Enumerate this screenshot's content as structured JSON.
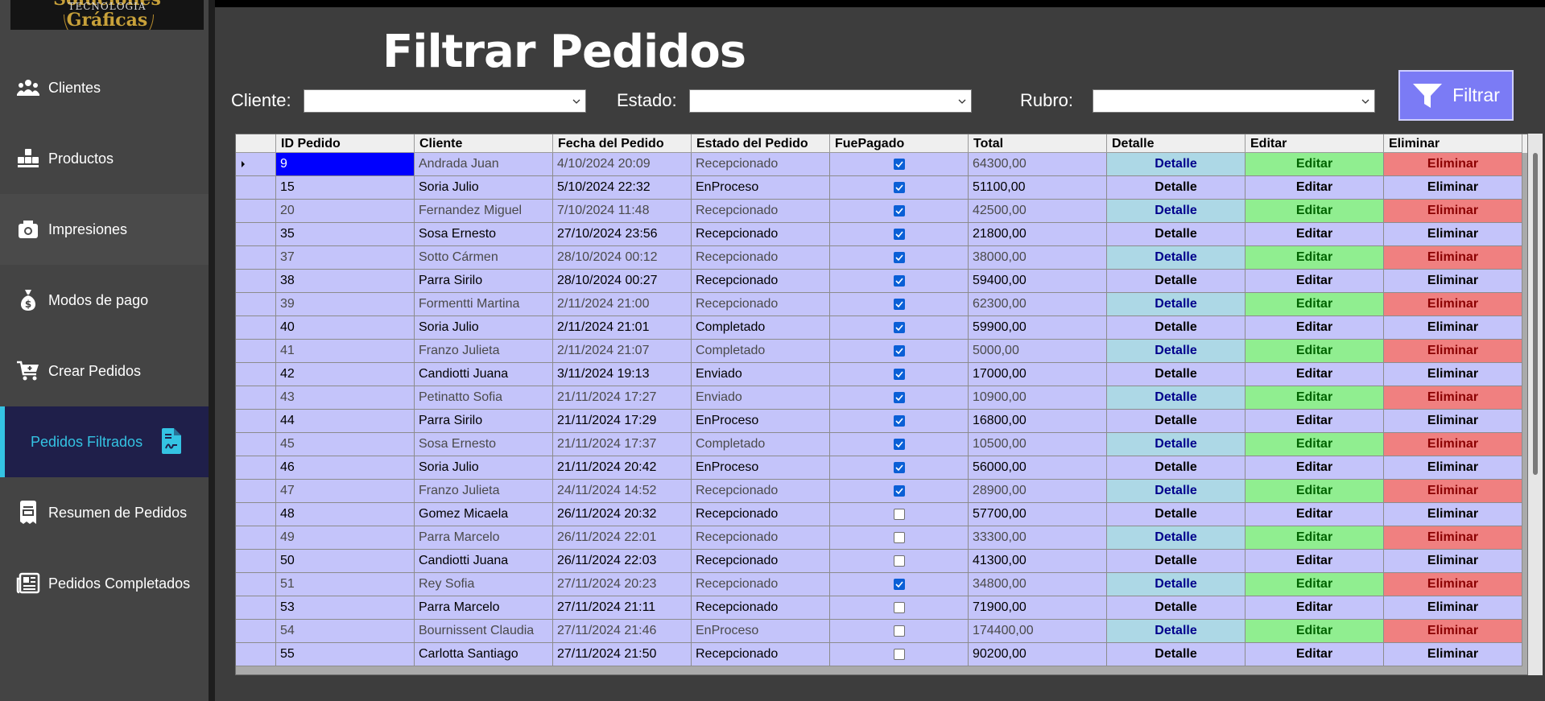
{
  "logo": {
    "brand": "Soluciones Gráficas",
    "sub": "TECNOLOGIA"
  },
  "sidebar": {
    "items": [
      {
        "label": "Clientes",
        "icon": "clients-icon"
      },
      {
        "label": "Productos",
        "icon": "products-icon"
      },
      {
        "label": "Impresiones",
        "icon": "print-icon"
      },
      {
        "label": "Modos de pago",
        "icon": "money-bag-icon"
      },
      {
        "label": "Crear Pedidos",
        "icon": "cart-icon"
      },
      {
        "label": "Pedidos Filtrados",
        "icon": "document-signature-icon"
      },
      {
        "label": "Resumen de Pedidos",
        "icon": "receipt-icon"
      },
      {
        "label": "Pedidos Completados",
        "icon": "newspaper-icon"
      }
    ],
    "active": "Pedidos Filtrados",
    "accent": "#34c3e3"
  },
  "page": {
    "title": "Filtrar Pedidos"
  },
  "filters": {
    "cliente_label": "Cliente:",
    "estado_label": "Estado:",
    "rubro_label": "Rubro:",
    "cliente_value": "",
    "estado_value": "",
    "rubro_value": "",
    "button_label": "Filtrar"
  },
  "table": {
    "columns": [
      "ID Pedido",
      "Cliente",
      "Fecha del Pedido",
      "Estado del Pedido",
      "FuePagado",
      "Total",
      "Detalle",
      "Editar",
      "Eliminar"
    ],
    "button_labels": {
      "detalle": "Detalle",
      "editar": "Editar",
      "eliminar": "Eliminar"
    },
    "rows": [
      {
        "id": "9",
        "cliente": "Andrada Juan",
        "fecha": "4/10/2024 20:09",
        "estado": "Recepcionado",
        "pagado": true,
        "total": "64300,00"
      },
      {
        "id": "15",
        "cliente": "Soria Julio",
        "fecha": "5/10/2024 22:32",
        "estado": "EnProceso",
        "pagado": true,
        "total": "51100,00"
      },
      {
        "id": "20",
        "cliente": "Fernandez Miguel",
        "fecha": "7/10/2024 11:48",
        "estado": "Recepcionado",
        "pagado": true,
        "total": "42500,00"
      },
      {
        "id": "35",
        "cliente": "Sosa Ernesto",
        "fecha": "27/10/2024 23:56",
        "estado": "Recepcionado",
        "pagado": true,
        "total": "21800,00"
      },
      {
        "id": "37",
        "cliente": "Sotto Cármen",
        "fecha": "28/10/2024 00:12",
        "estado": "Recepcionado",
        "pagado": true,
        "total": "38000,00"
      },
      {
        "id": "38",
        "cliente": "Parra Sirilo",
        "fecha": "28/10/2024 00:27",
        "estado": "Recepcionado",
        "pagado": true,
        "total": "59400,00"
      },
      {
        "id": "39",
        "cliente": "Formentti Martina",
        "fecha": "2/11/2024 21:00",
        "estado": "Recepcionado",
        "pagado": true,
        "total": "62300,00"
      },
      {
        "id": "40",
        "cliente": "Soria Julio",
        "fecha": "2/11/2024 21:01",
        "estado": "Completado",
        "pagado": true,
        "total": "59900,00"
      },
      {
        "id": "41",
        "cliente": "Franzo Julieta",
        "fecha": "2/11/2024 21:07",
        "estado": "Completado",
        "pagado": true,
        "total": "5000,00"
      },
      {
        "id": "42",
        "cliente": "Candiotti Juana",
        "fecha": "3/11/2024 19:13",
        "estado": "Enviado",
        "pagado": true,
        "total": "17000,00"
      },
      {
        "id": "43",
        "cliente": "Petinatto Sofia",
        "fecha": "21/11/2024 17:27",
        "estado": "Enviado",
        "pagado": true,
        "total": "10900,00"
      },
      {
        "id": "44",
        "cliente": "Parra Sirilo",
        "fecha": "21/11/2024 17:29",
        "estado": "EnProceso",
        "pagado": true,
        "total": "16800,00"
      },
      {
        "id": "45",
        "cliente": "Sosa Ernesto",
        "fecha": "21/11/2024 17:37",
        "estado": "Completado",
        "pagado": true,
        "total": "10500,00"
      },
      {
        "id": "46",
        "cliente": "Soria Julio",
        "fecha": "21/11/2024 20:42",
        "estado": "EnProceso",
        "pagado": true,
        "total": "56000,00"
      },
      {
        "id": "47",
        "cliente": "Franzo Julieta",
        "fecha": "24/11/2024 14:52",
        "estado": "Recepcionado",
        "pagado": true,
        "total": "28900,00"
      },
      {
        "id": "48",
        "cliente": "Gomez Micaela",
        "fecha": "26/11/2024 20:32",
        "estado": "Recepcionado",
        "pagado": false,
        "total": "57700,00"
      },
      {
        "id": "49",
        "cliente": "Parra Marcelo",
        "fecha": "26/11/2024 22:01",
        "estado": "Recepcionado",
        "pagado": false,
        "total": "33300,00"
      },
      {
        "id": "50",
        "cliente": "Candiotti Juana",
        "fecha": "26/11/2024 22:03",
        "estado": "Recepcionado",
        "pagado": false,
        "total": "41300,00"
      },
      {
        "id": "51",
        "cliente": "Rey Sofia",
        "fecha": "27/11/2024 20:23",
        "estado": "Recepcionado",
        "pagado": true,
        "total": "34800,00"
      },
      {
        "id": "53",
        "cliente": "Parra Marcelo",
        "fecha": "27/11/2024 21:11",
        "estado": "Recepcionado",
        "pagado": false,
        "total": "71900,00"
      },
      {
        "id": "54",
        "cliente": "Bournissent Claudia",
        "fecha": "27/11/2024 21:46",
        "estado": "EnProceso",
        "pagado": false,
        "total": "174400,00"
      },
      {
        "id": "55",
        "cliente": "Carlotta Santiago",
        "fecha": "27/11/2024 21:50",
        "estado": "Recepcionado",
        "pagado": false,
        "total": "90200,00"
      }
    ],
    "selected_row": 0
  }
}
